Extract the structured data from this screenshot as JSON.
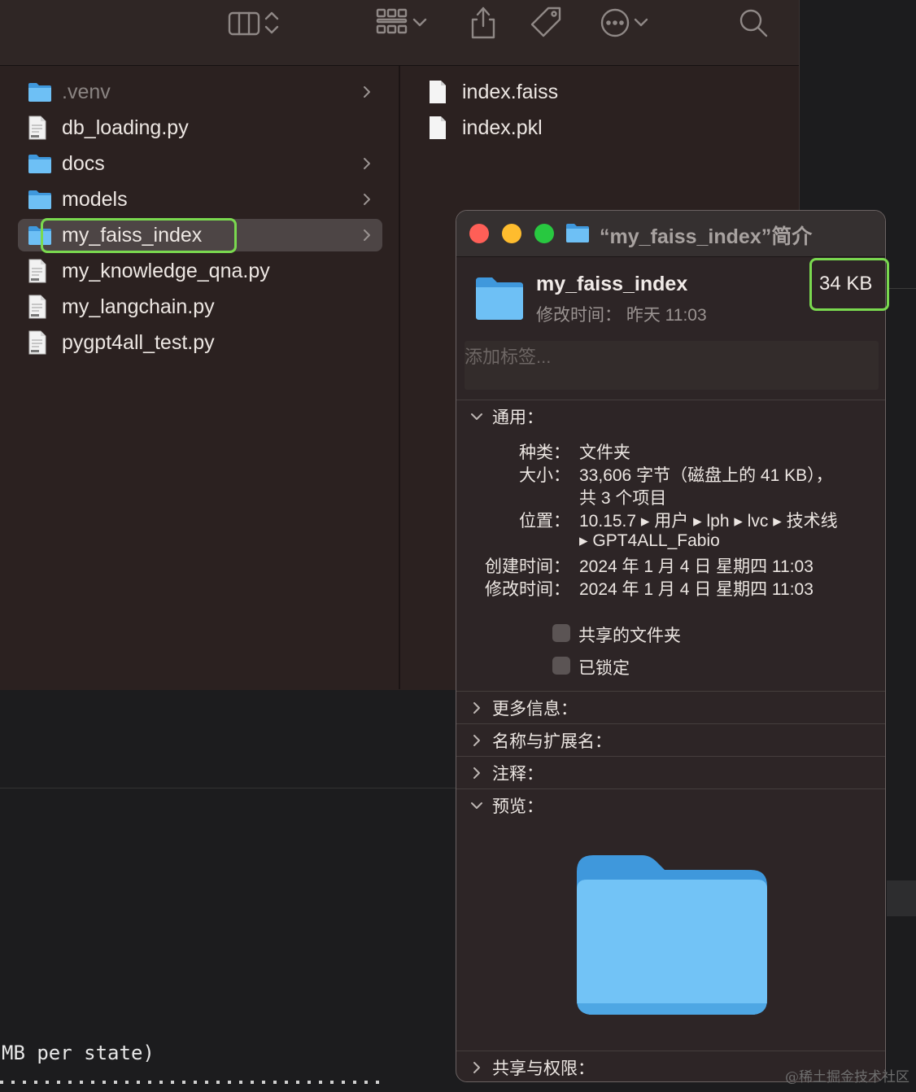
{
  "finder": {
    "column1": [
      {
        "name": ".venv",
        "type": "folder",
        "expandable": true
      },
      {
        "name": "db_loading.py",
        "type": "python-file",
        "expandable": false
      },
      {
        "name": "docs",
        "type": "folder",
        "expandable": true
      },
      {
        "name": "models",
        "type": "folder",
        "expandable": true
      },
      {
        "name": "my_faiss_index",
        "type": "folder",
        "expandable": true,
        "selected": true
      },
      {
        "name": "my_knowledge_qna.py",
        "type": "python-file",
        "expandable": false
      },
      {
        "name": "my_langchain.py",
        "type": "python-file",
        "expandable": false
      },
      {
        "name": "pygpt4all_test.py",
        "type": "python-file",
        "expandable": false
      }
    ],
    "column2": [
      {
        "name": "index.faiss",
        "type": "file"
      },
      {
        "name": "index.pkl",
        "type": "file"
      }
    ]
  },
  "info": {
    "title": "“my_faiss_index”简介",
    "name": "my_faiss_index",
    "modified_label": "修改时间：",
    "modified_value": "昨天 11:03",
    "size_badge": "34 KB",
    "tags_placeholder": "添加标签...",
    "general_label": "通用：",
    "kind_label": "种类：",
    "kind_value": "文件夹",
    "size_label": "大小：",
    "size_value_1": "33,606 字节（磁盘上的 41 KB），",
    "size_value_2": "共 3 个项目",
    "where_label": "位置：",
    "where_value_1": "10.15.7 ▸ 用户 ▸ lph ▸ lvc ▸ 技术线",
    "where_value_2": "▸ GPT4ALL_Fabio",
    "created_label": "创建时间：",
    "created_value": "2024 年 1 月 4 日 星期四 11:03",
    "modified2_label": "修改时间：",
    "modified2_value": "2024 年 1 月 4 日 星期四 11:03",
    "shared_folder_label": "共享的文件夹",
    "locked_label": "已锁定",
    "more_info_label": "更多信息：",
    "name_ext_label": "名称与扩展名：",
    "comments_label": "注释：",
    "preview_label": "预览：",
    "sharing_label": "共享与权限："
  },
  "terminal": {
    "text": "MB per state)"
  },
  "watermark": "@稀土掘金技术社区",
  "colors": {
    "highlight": "#7ad94f",
    "folder": "#5fb5ee",
    "close": "#fe5f57",
    "minimize": "#febc2e",
    "zoom": "#28c840"
  }
}
